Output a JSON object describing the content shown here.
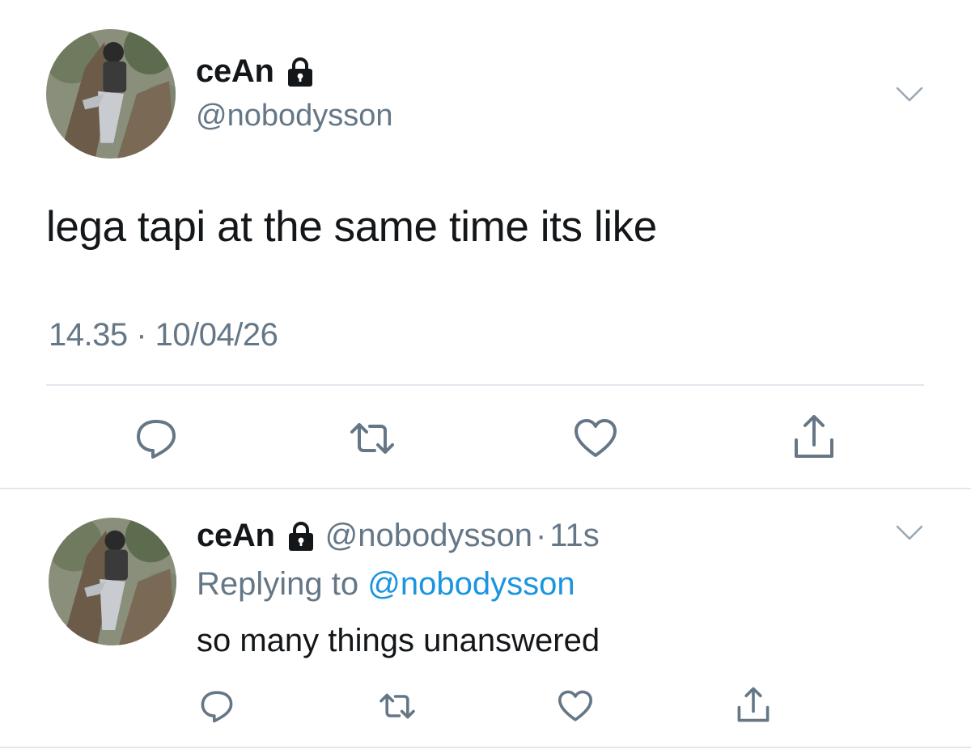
{
  "main_tweet": {
    "display_name": "ceAn",
    "handle": "@nobodysson",
    "text": "lega tapi at the same time its like",
    "timestamp": "14.35 · 10/04/26",
    "locked": true,
    "icons": {
      "lock": "lock-icon",
      "menu": "chevron-down-icon",
      "reply": "comment-bubble-icon",
      "retweet": "retweet-icon",
      "like": "heart-icon",
      "share": "share-icon"
    }
  },
  "reply_tweet": {
    "display_name": "ceAn",
    "handle": "@nobodysson",
    "separator": "·",
    "time_ago": "11s",
    "replying_prefix": "Replying to",
    "replying_to": "@nobodysson",
    "text": "so many things unanswered",
    "locked": true
  },
  "colors": {
    "text_primary": "#14171a",
    "text_secondary": "#657786",
    "link": "#1b95e0",
    "divider": "#e1e8ed",
    "icon": "#657786"
  }
}
